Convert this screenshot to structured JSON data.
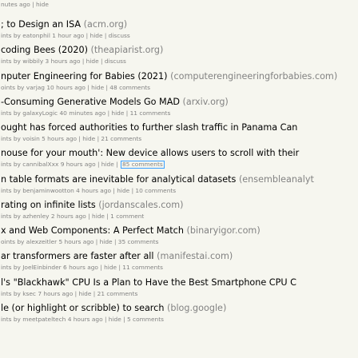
{
  "stories": [
    {
      "title": "",
      "domain": "",
      "sub": [
        {
          "t": "nutes ago | hide"
        }
      ]
    },
    {
      "title": "; to Design an ISA",
      "domain": "(acm.org)",
      "sub": [
        {
          "t": "ints by eatonphil 1 hour ago | hide | discuss"
        }
      ]
    },
    {
      "title": "coding Bees (2020)",
      "domain": "(theapiarist.org)",
      "sub": [
        {
          "t": "ints by wibbily 3 hours ago | hide | discuss"
        }
      ]
    },
    {
      "title": "nputer Engineering for Babies (2021)",
      "domain": "(computerengineeringforbabies.com)",
      "sub": [
        {
          "t": "oints by varjag 10 hours ago | hide | 48 comments"
        }
      ]
    },
    {
      "title": "-Consuming Generative Models Go MAD",
      "domain": "(arxiv.org)",
      "sub": [
        {
          "t": "ints by galaxyLogic 40 minutes ago | hide | 11 comments"
        }
      ]
    },
    {
      "title": "ought has forced authorities to further slash traffic in Panama Can",
      "domain": "",
      "sub": [
        {
          "t": "ints by voisin 5 hours ago | hide | 21 comments"
        }
      ]
    },
    {
      "title": "nouse for your mouth': New device allows users to scroll with their",
      "domain": "",
      "sub": [
        {
          "t": "ints by cannibalXxx 9 hours ago | hide | "
        },
        {
          "t": "85 comments",
          "hl": true
        }
      ]
    },
    {
      "title": "n table formats are inevitable for analytical datasets",
      "domain": "(ensembleanalyt",
      "sub": [
        {
          "t": "ints by benjaminwootton 4 hours ago | hide | 10 comments"
        }
      ]
    },
    {
      "title": "rating on infinite lists",
      "domain": "(jordanscales.com)",
      "sub": [
        {
          "t": "ints by azhenley 2 hours ago | hide | 1 comment"
        }
      ]
    },
    {
      "title": "x and Web Components: A Perfect Match",
      "domain": "(binaryigor.com)",
      "sub": [
        {
          "t": "oints by alexzeitler 5 hours ago | hide | 35 comments"
        }
      ]
    },
    {
      "title": "ar transformers are faster after all",
      "domain": "(manifestai.com)",
      "sub": [
        {
          "t": "ints by JoelEinbinder 6 hours ago | hide | 11 comments"
        }
      ]
    },
    {
      "title": "l's \"Blackhawk\" CPU Is a Plan to Have the Best Smartphone CPU C",
      "domain": "",
      "sub": [
        {
          "t": "ints by ksec 7 hours ago | hide | 21 comments"
        }
      ]
    },
    {
      "title": "le (or highlight or scribble) to search",
      "domain": "(blog.google)",
      "sub": [
        {
          "t": "ints by meetpateltech 4 hours ago | hide | 5 comments"
        }
      ]
    }
  ]
}
